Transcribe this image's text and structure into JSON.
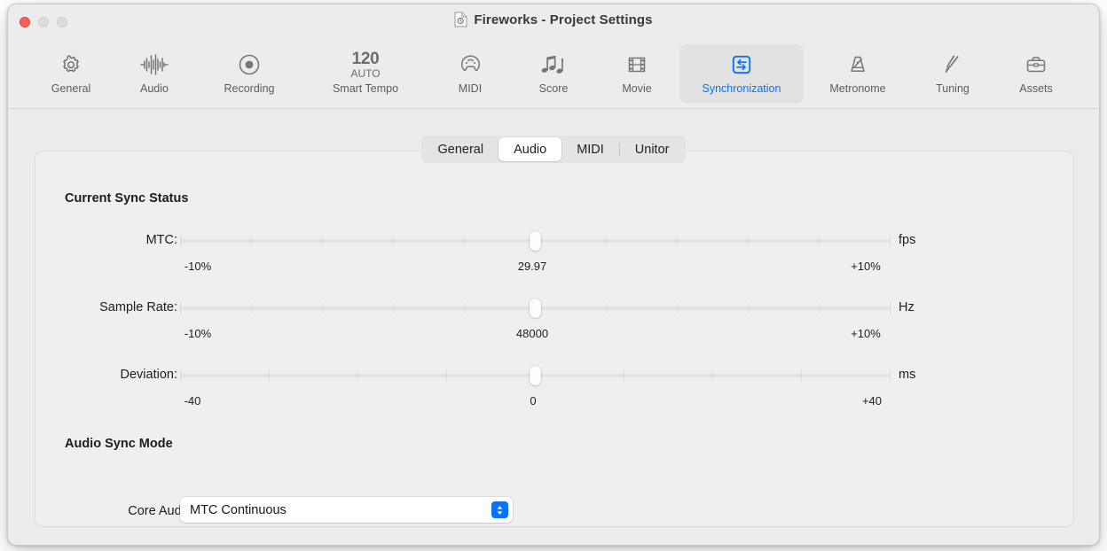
{
  "window": {
    "title": "Fireworks - Project Settings",
    "doc_icon": "document-icon",
    "traffic_lights": {
      "close": "close-button",
      "minimize": "minimize-button",
      "zoom": "zoom-button"
    }
  },
  "toolbar": {
    "items": [
      {
        "label": "General",
        "icon": "gear-icon",
        "selected": false
      },
      {
        "label": "Audio",
        "icon": "waveform-icon",
        "selected": false
      },
      {
        "label": "Recording",
        "icon": "record-dot-icon",
        "selected": false
      },
      {
        "label": "Smart Tempo",
        "icon": "tempo-120-auto-icon",
        "selected": false,
        "tempo_number": "120",
        "tempo_mode": "AUTO"
      },
      {
        "label": "MIDI",
        "icon": "midi-port-icon",
        "selected": false
      },
      {
        "label": "Score",
        "icon": "music-notes-icon",
        "selected": false
      },
      {
        "label": "Movie",
        "icon": "film-strip-icon",
        "selected": false
      },
      {
        "label": "Synchronization",
        "icon": "sync-arrows-icon",
        "selected": true
      },
      {
        "label": "Metronome",
        "icon": "metronome-icon",
        "selected": false
      },
      {
        "label": "Tuning",
        "icon": "tuning-fork-icon",
        "selected": false
      },
      {
        "label": "Assets",
        "icon": "briefcase-icon",
        "selected": false
      }
    ]
  },
  "tabs": {
    "items": [
      {
        "label": "General",
        "active": false
      },
      {
        "label": "Audio",
        "active": true
      },
      {
        "label": "MIDI",
        "active": false
      },
      {
        "label": "Unitor",
        "active": false
      }
    ]
  },
  "sections": {
    "sync_status_title": "Current Sync Status",
    "audio_sync_title": "Audio Sync Mode"
  },
  "sliders": [
    {
      "label": "MTC:",
      "unit": "fps",
      "value_text": "29.97",
      "min_label": "-10%",
      "max_label": "+10%",
      "position_pct": 50,
      "segments": 10
    },
    {
      "label": "Sample Rate:",
      "unit": "Hz",
      "value_text": "48000",
      "min_label": "-10%",
      "max_label": "+10%",
      "position_pct": 50,
      "segments": 10
    },
    {
      "label": "Deviation:",
      "unit": "ms",
      "value_text": "0",
      "min_label": "-40",
      "max_label": "+40",
      "position_pct": 50,
      "segments": 8
    }
  ],
  "popup": {
    "label": "Core Audio:",
    "value": "MTC Continuous",
    "arrows_icon": "chevron-up-down-icon",
    "accent_color": "#0a72f5"
  },
  "colors": {
    "accent": "#0a72f5",
    "window_bg": "#ececec",
    "panel_bg": "#efefef",
    "close_red": "#ff5f57"
  }
}
